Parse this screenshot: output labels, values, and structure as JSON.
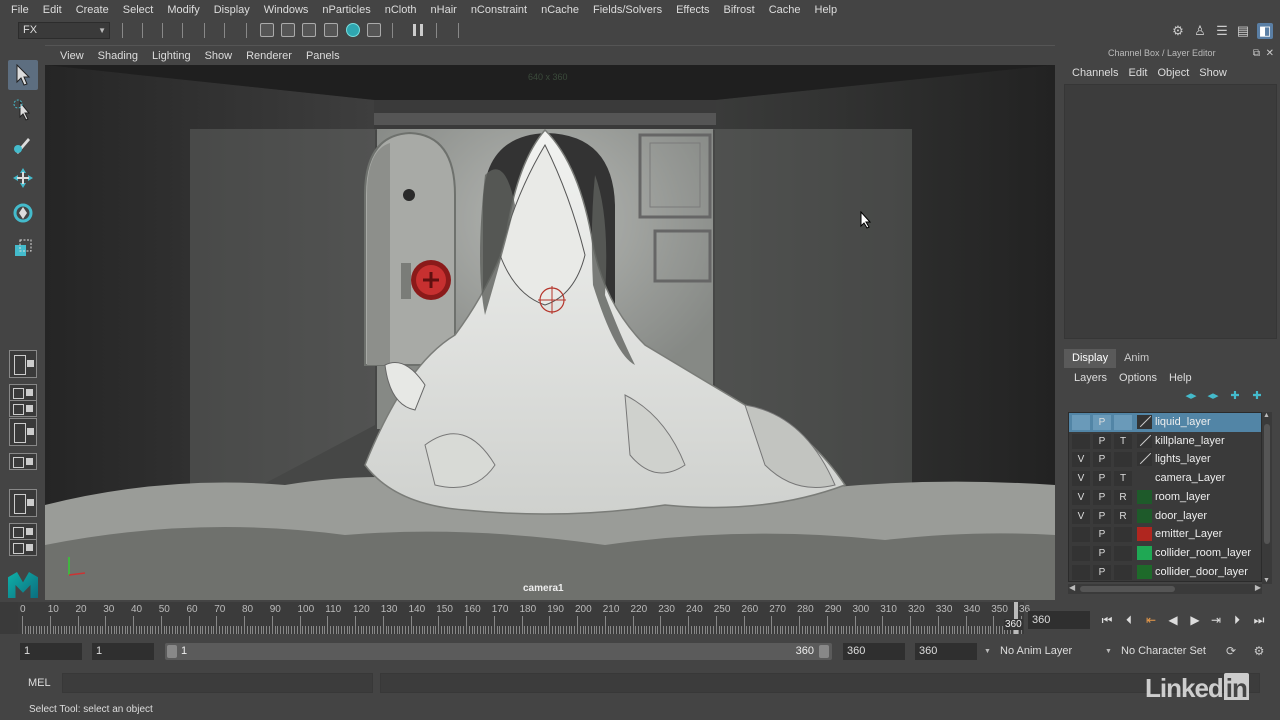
{
  "menubar": [
    "File",
    "Edit",
    "Create",
    "Select",
    "Modify",
    "Display",
    "Windows",
    "nParticles",
    "nCloth",
    "nHair",
    "nConstraint",
    "nCache",
    "Fields/Solvers",
    "Effects",
    "Bifrost",
    "Cache",
    "Help"
  ],
  "shelf": {
    "mode": "FX"
  },
  "viewport": {
    "menu": [
      "View",
      "Shading",
      "Lighting",
      "Show",
      "Renderer",
      "Panels"
    ],
    "resolution": "640 x 360",
    "camera": "camera1"
  },
  "channel_box": {
    "title": "Channel Box / Layer Editor",
    "menu": [
      "Channels",
      "Edit",
      "Object",
      "Show"
    ]
  },
  "layer_editor": {
    "tabs": [
      "Display",
      "Anim"
    ],
    "active_tab": "Display",
    "menu": [
      "Layers",
      "Options",
      "Help"
    ],
    "layers": [
      {
        "v": "",
        "p": "P",
        "t": "",
        "color": "line",
        "name": "liquid_layer",
        "selected": true
      },
      {
        "v": "",
        "p": "P",
        "t": "T",
        "color": "line",
        "name": "killplane_layer",
        "selected": false
      },
      {
        "v": "V",
        "p": "P",
        "t": "",
        "color": "line",
        "name": "lights_layer",
        "selected": false
      },
      {
        "v": "V",
        "p": "P",
        "t": "T",
        "color": "#3a3a3a",
        "name": "camera_Layer",
        "selected": false
      },
      {
        "v": "V",
        "p": "P",
        "t": "R",
        "color": "#1e5a2a",
        "name": "room_layer",
        "selected": false
      },
      {
        "v": "V",
        "p": "P",
        "t": "R",
        "color": "#1e5a2a",
        "name": "door_layer",
        "selected": false
      },
      {
        "v": "",
        "p": "P",
        "t": "",
        "color": "#b0261f",
        "name": "emitter_Layer",
        "selected": false
      },
      {
        "v": "",
        "p": "P",
        "t": "",
        "color": "#1fa854",
        "name": "collider_room_layer",
        "selected": false
      },
      {
        "v": "",
        "p": "P",
        "t": "",
        "color": "#1e6a2a",
        "name": "collider_door_layer",
        "selected": false
      }
    ]
  },
  "timeline": {
    "ticks": [
      "0",
      "10",
      "20",
      "30",
      "40",
      "50",
      "60",
      "70",
      "80",
      "90",
      "100",
      "110",
      "120",
      "130",
      "140",
      "150",
      "160",
      "170",
      "180",
      "190",
      "200",
      "210",
      "220",
      "230",
      "240",
      "250",
      "260",
      "270",
      "280",
      "290",
      "300",
      "310",
      "320",
      "330",
      "340",
      "350",
      "36"
    ],
    "current_frame": "360",
    "end_frame": "360"
  },
  "range": {
    "start": "1",
    "start_inner": "1",
    "bar_start": "1",
    "bar_end": "360",
    "end_inner": "360",
    "end": "360",
    "anim_layer": "No Anim Layer",
    "character_set": "No Character Set"
  },
  "command": {
    "label": "MEL"
  },
  "status": "Select Tool: select an object",
  "watermark": {
    "text": "Linked",
    "in": "in"
  }
}
